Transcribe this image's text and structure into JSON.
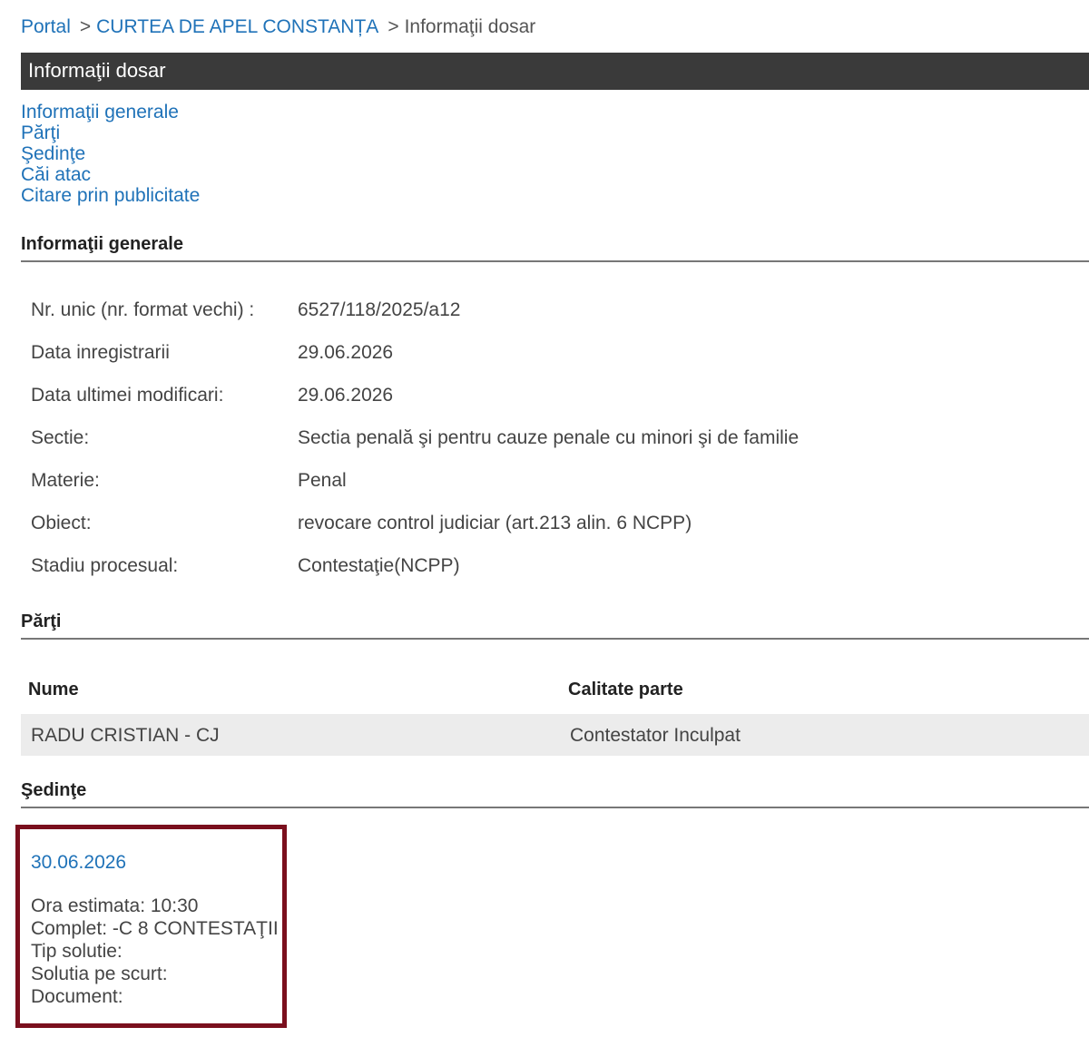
{
  "breadcrumb": {
    "items": [
      "Portal",
      "CURTEA DE APEL CONSTANȚA",
      "Informaţii dosar"
    ],
    "separator": ">"
  },
  "page_title": "Informaţii dosar",
  "nav": {
    "links": [
      "Informaţii generale",
      "Părţi",
      "Şedinţe",
      "Căi atac",
      "Citare prin publicitate"
    ]
  },
  "general": {
    "heading": "Informaţii generale",
    "rows": [
      {
        "label": "Nr. unic (nr. format vechi) :",
        "value": "6527/118/2025/a12"
      },
      {
        "label": "Data inregistrarii",
        "value": "29.06.2026"
      },
      {
        "label": "Data ultimei modificari:",
        "value": "29.06.2026"
      },
      {
        "label": "Sectie:",
        "value": "Sectia penală şi pentru cauze penale cu minori şi de familie"
      },
      {
        "label": "Materie:",
        "value": "Penal"
      },
      {
        "label": "Obiect:",
        "value": "revocare control judiciar (art.213 alin. 6 NCPP)"
      },
      {
        "label": "Stadiu procesual:",
        "value": "Contestaţie(NCPP)"
      }
    ]
  },
  "parti": {
    "heading": "Părţi",
    "columns": [
      "Nume",
      "Calitate parte"
    ],
    "rows": [
      {
        "nume": "RADU CRISTIAN - CJ",
        "calitate": "Contestator Inculpat"
      }
    ]
  },
  "sedinte": {
    "heading": "Şedinţe",
    "date": "30.06.2026",
    "details": [
      "Ora estimata: 10:30",
      "Complet: -C 8 CONTESTAŢII",
      "Tip solutie:",
      "Solutia pe scurt:",
      "Document:"
    ]
  },
  "colors": {
    "link": "#1f72b8",
    "title_bar": "#3a3a3a",
    "highlight_border": "#7a0f1d",
    "row_background": "#ececec"
  }
}
